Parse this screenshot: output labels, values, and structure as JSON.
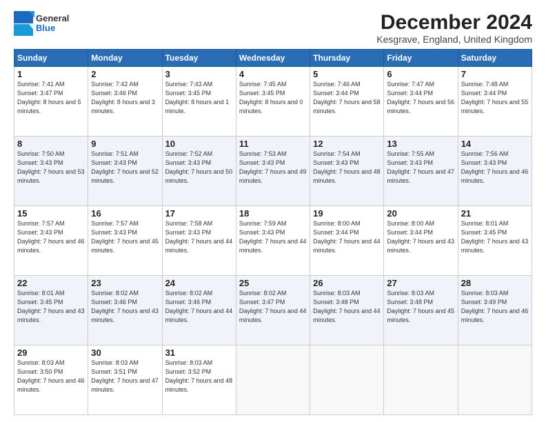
{
  "header": {
    "logo": {
      "general": "General",
      "blue": "Blue"
    },
    "title": "December 2024",
    "subtitle": "Kesgrave, England, United Kingdom"
  },
  "days_of_week": [
    "Sunday",
    "Monday",
    "Tuesday",
    "Wednesday",
    "Thursday",
    "Friday",
    "Saturday"
  ],
  "weeks": [
    [
      {
        "day": 1,
        "sunrise": "7:41 AM",
        "sunset": "3:47 PM",
        "daylight": "8 hours and 5 minutes."
      },
      {
        "day": 2,
        "sunrise": "7:42 AM",
        "sunset": "3:46 PM",
        "daylight": "8 hours and 3 minutes."
      },
      {
        "day": 3,
        "sunrise": "7:43 AM",
        "sunset": "3:45 PM",
        "daylight": "8 hours and 1 minute."
      },
      {
        "day": 4,
        "sunrise": "7:45 AM",
        "sunset": "3:45 PM",
        "daylight": "8 hours and 0 minutes."
      },
      {
        "day": 5,
        "sunrise": "7:46 AM",
        "sunset": "3:44 PM",
        "daylight": "7 hours and 58 minutes."
      },
      {
        "day": 6,
        "sunrise": "7:47 AM",
        "sunset": "3:44 PM",
        "daylight": "7 hours and 56 minutes."
      },
      {
        "day": 7,
        "sunrise": "7:48 AM",
        "sunset": "3:44 PM",
        "daylight": "7 hours and 55 minutes."
      }
    ],
    [
      {
        "day": 8,
        "sunrise": "7:50 AM",
        "sunset": "3:43 PM",
        "daylight": "7 hours and 53 minutes."
      },
      {
        "day": 9,
        "sunrise": "7:51 AM",
        "sunset": "3:43 PM",
        "daylight": "7 hours and 52 minutes."
      },
      {
        "day": 10,
        "sunrise": "7:52 AM",
        "sunset": "3:43 PM",
        "daylight": "7 hours and 50 minutes."
      },
      {
        "day": 11,
        "sunrise": "7:53 AM",
        "sunset": "3:43 PM",
        "daylight": "7 hours and 49 minutes."
      },
      {
        "day": 12,
        "sunrise": "7:54 AM",
        "sunset": "3:43 PM",
        "daylight": "7 hours and 48 minutes."
      },
      {
        "day": 13,
        "sunrise": "7:55 AM",
        "sunset": "3:43 PM",
        "daylight": "7 hours and 47 minutes."
      },
      {
        "day": 14,
        "sunrise": "7:56 AM",
        "sunset": "3:43 PM",
        "daylight": "7 hours and 46 minutes."
      }
    ],
    [
      {
        "day": 15,
        "sunrise": "7:57 AM",
        "sunset": "3:43 PM",
        "daylight": "7 hours and 46 minutes."
      },
      {
        "day": 16,
        "sunrise": "7:57 AM",
        "sunset": "3:43 PM",
        "daylight": "7 hours and 45 minutes."
      },
      {
        "day": 17,
        "sunrise": "7:58 AM",
        "sunset": "3:43 PM",
        "daylight": "7 hours and 44 minutes."
      },
      {
        "day": 18,
        "sunrise": "7:59 AM",
        "sunset": "3:43 PM",
        "daylight": "7 hours and 44 minutes."
      },
      {
        "day": 19,
        "sunrise": "8:00 AM",
        "sunset": "3:44 PM",
        "daylight": "7 hours and 44 minutes."
      },
      {
        "day": 20,
        "sunrise": "8:00 AM",
        "sunset": "3:44 PM",
        "daylight": "7 hours and 43 minutes."
      },
      {
        "day": 21,
        "sunrise": "8:01 AM",
        "sunset": "3:45 PM",
        "daylight": "7 hours and 43 minutes."
      }
    ],
    [
      {
        "day": 22,
        "sunrise": "8:01 AM",
        "sunset": "3:45 PM",
        "daylight": "7 hours and 43 minutes."
      },
      {
        "day": 23,
        "sunrise": "8:02 AM",
        "sunset": "3:46 PM",
        "daylight": "7 hours and 43 minutes."
      },
      {
        "day": 24,
        "sunrise": "8:02 AM",
        "sunset": "3:46 PM",
        "daylight": "7 hours and 44 minutes."
      },
      {
        "day": 25,
        "sunrise": "8:02 AM",
        "sunset": "3:47 PM",
        "daylight": "7 hours and 44 minutes."
      },
      {
        "day": 26,
        "sunrise": "8:03 AM",
        "sunset": "3:48 PM",
        "daylight": "7 hours and 44 minutes."
      },
      {
        "day": 27,
        "sunrise": "8:03 AM",
        "sunset": "3:48 PM",
        "daylight": "7 hours and 45 minutes."
      },
      {
        "day": 28,
        "sunrise": "8:03 AM",
        "sunset": "3:49 PM",
        "daylight": "7 hours and 46 minutes."
      }
    ],
    [
      {
        "day": 29,
        "sunrise": "8:03 AM",
        "sunset": "3:50 PM",
        "daylight": "7 hours and 46 minutes."
      },
      {
        "day": 30,
        "sunrise": "8:03 AM",
        "sunset": "3:51 PM",
        "daylight": "7 hours and 47 minutes."
      },
      {
        "day": 31,
        "sunrise": "8:03 AM",
        "sunset": "3:52 PM",
        "daylight": "7 hours and 48 minutes."
      },
      null,
      null,
      null,
      null
    ]
  ]
}
